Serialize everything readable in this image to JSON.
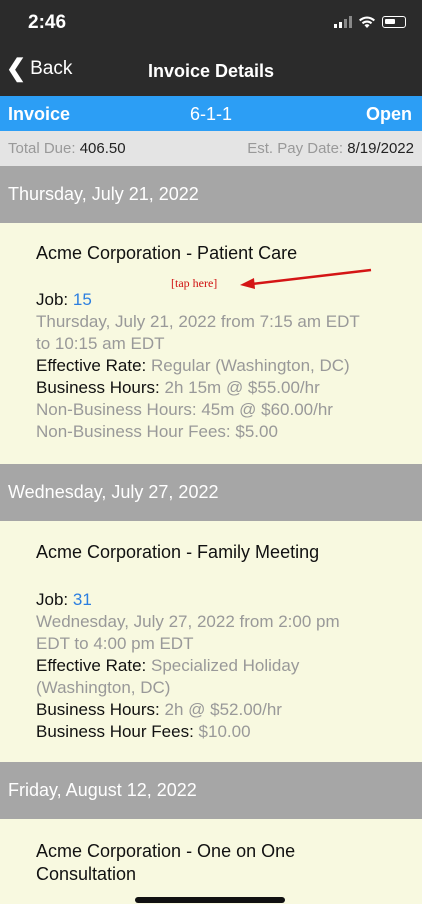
{
  "status": {
    "time": "2:46"
  },
  "nav": {
    "back_label": "Back",
    "title": "Invoice Details"
  },
  "invoice": {
    "label": "Invoice",
    "number": "6-1-1",
    "status": "Open"
  },
  "totals": {
    "due_label": "Total Due:",
    "due_value": "406.50",
    "pay_label": "Est. Pay Date:",
    "pay_value": "8/19/2022"
  },
  "annotation": {
    "text": "[tap here]"
  },
  "days": [
    {
      "header": "Thursday, July 21, 2022",
      "title": "Acme Corporation - Patient Care",
      "job_label": "Job:",
      "job_number": "15",
      "datetime_1": "Thursday, July 21, 2022 from 7:15 am EDT",
      "datetime_2": "to 10:15 am EDT",
      "rate_label": "Effective Rate:",
      "rate_value": "Regular (Washington, DC)",
      "bh_label": "Business Hours:",
      "bh_value": "2h 15m @ $55.00/hr",
      "nbh_text": "Non-Business Hours: 45m @ $60.00/hr",
      "nbh_fee_text": "Non-Business Hour Fees: $5.00"
    },
    {
      "header": "Wednesday, July 27, 2022",
      "title": "Acme Corporation - Family Meeting",
      "job_label": "Job:",
      "job_number": "31",
      "datetime_1": "Wednesday, July 27, 2022 from 2:00 pm",
      "datetime_2": "EDT to 4:00 pm EDT",
      "rate_label": "Effective Rate:",
      "rate_value_1": "Specialized Holiday",
      "rate_value_2": "(Washington, DC)",
      "bh_label": "Business Hours:",
      "bh_value": "2h @ $52.00/hr",
      "bh_fee_label": "Business Hour Fees:",
      "bh_fee_value": "$10.00"
    },
    {
      "header": "Friday, August 12, 2022",
      "title_1": "Acme Corporation - One on One",
      "title_2": "Consultation"
    }
  ]
}
